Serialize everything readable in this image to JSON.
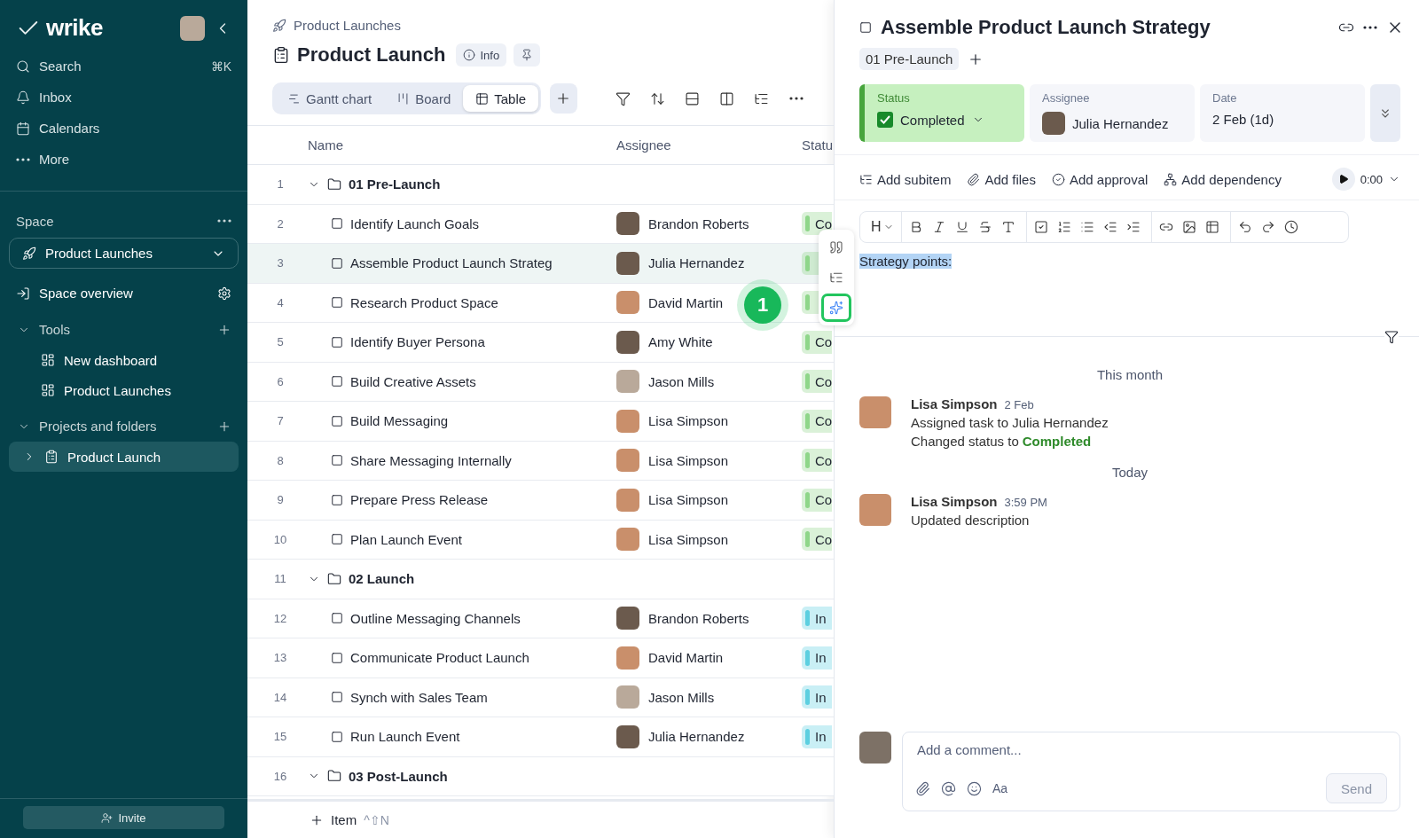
{
  "sidebar": {
    "logo": "wrike",
    "nav": [
      {
        "label": "Search",
        "shortcut": "⌘K"
      },
      {
        "label": "Inbox"
      },
      {
        "label": "Calendars"
      },
      {
        "label": "More"
      }
    ],
    "space_label": "Space",
    "space_select": "Product Launches",
    "space_overview": "Space overview",
    "sections": [
      {
        "title": "Tools",
        "expanded": true,
        "items": [
          {
            "kind": "dashboard",
            "label": "New dashboard",
            "selected": false
          },
          {
            "kind": "dashboard",
            "label": "Product Launches",
            "selected": false
          }
        ]
      },
      {
        "title": "Projects and folders",
        "expanded": true,
        "items": [
          {
            "kind": "project",
            "label": "Product Launch",
            "selected": true
          }
        ]
      }
    ],
    "invite": "Invite"
  },
  "header": {
    "breadcrumb": "Product Launches",
    "title": "Product Launch",
    "info": "Info",
    "views": [
      {
        "label": "Gantt chart",
        "selected": false
      },
      {
        "label": "Board",
        "selected": false
      },
      {
        "label": "Table",
        "selected": true
      }
    ]
  },
  "table": {
    "columns": [
      "Name",
      "Assignee",
      "Statu"
    ],
    "rows": [
      {
        "num": "1",
        "kind": "folder",
        "name": "01 Pre-Launch",
        "expanded": true,
        "selected": false
      },
      {
        "num": "2",
        "kind": "task",
        "name": "Identify Launch Goals",
        "assignee": "Brandon Roberts",
        "status": "Co",
        "color": "#8fd68a",
        "selected": false
      },
      {
        "num": "3",
        "kind": "task",
        "name": "Assemble Product Launch Strateg",
        "assignee": "Julia Hernandez",
        "color": "#8fd68a",
        "selected": true
      },
      {
        "num": "4",
        "kind": "task",
        "name": "Research Product Space",
        "assignee": "David Martin",
        "color": "#8fd68a",
        "selected": false
      },
      {
        "num": "5",
        "kind": "task",
        "name": "Identify Buyer Persona",
        "assignee": "Amy White",
        "status": "Co",
        "color": "#8fd68a",
        "selected": false
      },
      {
        "num": "6",
        "kind": "task",
        "name": "Build Creative Assets",
        "assignee": "Jason Mills",
        "status": "Co",
        "color": "#8fd68a",
        "selected": false
      },
      {
        "num": "7",
        "kind": "task",
        "name": "Build Messaging",
        "assignee": "Lisa Simpson",
        "status": "Co",
        "color": "#8fd68a",
        "selected": false
      },
      {
        "num": "8",
        "kind": "task",
        "name": "Share Messaging Internally",
        "assignee": "Lisa Simpson",
        "status": "Co",
        "color": "#8fd68a",
        "selected": false
      },
      {
        "num": "9",
        "kind": "task",
        "name": "Prepare Press Release",
        "assignee": "Lisa Simpson",
        "status": "Co",
        "color": "#8fd68a",
        "selected": false
      },
      {
        "num": "10",
        "kind": "task",
        "name": "Plan Launch Event",
        "assignee": "Lisa Simpson",
        "status": "Co",
        "color": "#8fd68a",
        "selected": false
      },
      {
        "num": "11",
        "kind": "folder",
        "name": "02 Launch",
        "expanded": true,
        "selected": false
      },
      {
        "num": "12",
        "kind": "task",
        "name": "Outline Messaging Channels",
        "assignee": "Brandon Roberts",
        "status": "In",
        "color": "#5ccfe0",
        "selected": false
      },
      {
        "num": "13",
        "kind": "task",
        "name": "Communicate Product Launch",
        "assignee": "David Martin",
        "status": "In",
        "color": "#5ccfe0",
        "selected": false
      },
      {
        "num": "14",
        "kind": "task",
        "name": "Synch with Sales Team",
        "assignee": "Jason Mills",
        "status": "In",
        "color": "#5ccfe0",
        "selected": false
      },
      {
        "num": "15",
        "kind": "task",
        "name": "Run Launch Event",
        "assignee": "Julia Hernandez",
        "status": "In",
        "color": "#5ccfe0",
        "selected": false
      },
      {
        "num": "16",
        "kind": "folder",
        "name": "03 Post-Launch",
        "expanded": true,
        "selected": false
      }
    ],
    "add_item": "Item",
    "add_item_shortcut": "^⇧N"
  },
  "callout": {
    "number": "1"
  },
  "task": {
    "title": "Assemble Product Launch Strategy",
    "tag": "01 Pre-Launch",
    "fields": [
      {
        "kind": "status",
        "label": "Status",
        "value": "Completed",
        "checked": true
      },
      {
        "kind": "assignee",
        "label": "Assignee",
        "value": "Julia Hernandez"
      },
      {
        "kind": "date",
        "label": "Date",
        "value": "2 Feb (1d)"
      }
    ],
    "actions": [
      "Add subitem",
      "Add files",
      "Add approval",
      "Add dependency"
    ],
    "timer": "0:00",
    "editor_heading": "H",
    "description": "Strategy points:",
    "description_selected": true,
    "activity": [
      {
        "kind": "divider",
        "label": "This month"
      },
      {
        "kind": "entry",
        "author": "Lisa Simpson",
        "time": "2 Feb",
        "lines": [
          "Assigned task to Julia Hernandez"
        ],
        "status_text": "Changed status to",
        "status_value": "Completed"
      },
      {
        "kind": "divider",
        "label": "Today"
      },
      {
        "kind": "entry",
        "author": "Lisa Simpson",
        "time": "3:59 PM",
        "lines": [
          "Updated description"
        ]
      }
    ],
    "comment": {
      "placeholder": "Add a comment...",
      "format": "Aa",
      "send": "Send"
    }
  }
}
